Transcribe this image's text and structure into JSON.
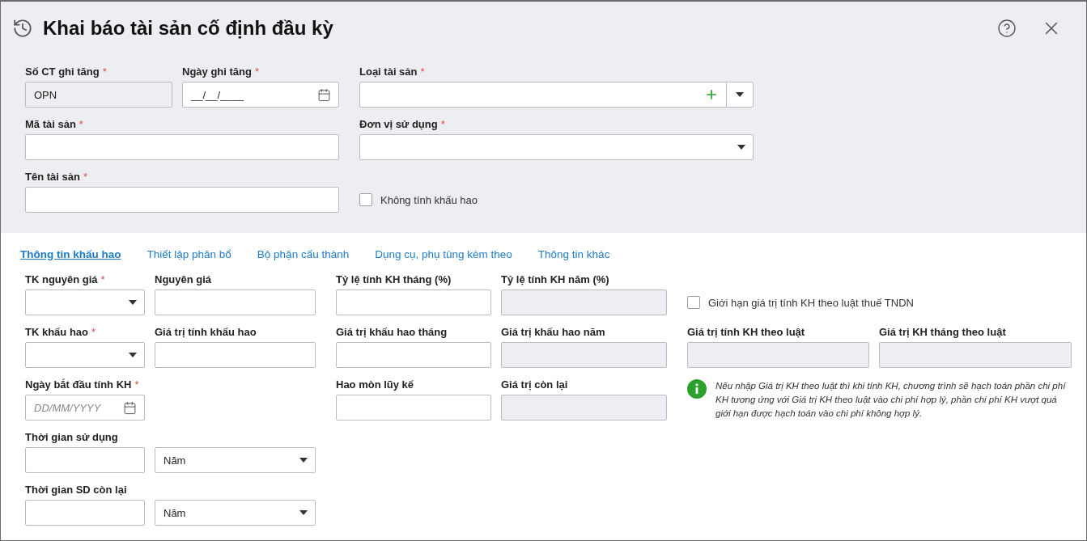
{
  "window": {
    "title": "Khai báo tài sản cố định đầu kỳ"
  },
  "top_fields": [
    {
      "kind": "text",
      "label": "Số CT ghi tăng",
      "required_mark": "*",
      "value": "OPN",
      "disabled": true
    },
    {
      "kind": "date",
      "label": "Ngày ghi tăng",
      "required_mark": "*",
      "value": "__/__/____",
      "disabled": false
    },
    {
      "kind": "combo_add",
      "label": "Loại tài sản",
      "required_mark": "*",
      "disabled": false
    },
    {
      "kind": "text",
      "label": "Mã tài sản",
      "required_mark": "*",
      "disabled": false
    },
    {
      "kind": "combo",
      "label": "Đơn vị sử dụng",
      "required_mark": "*",
      "disabled": false
    },
    {
      "kind": "text",
      "label": "Tên tài sản",
      "required_mark": "*",
      "disabled": false
    },
    {
      "kind": "checkbox",
      "label": "Không tính khấu hao",
      "checked": false
    }
  ],
  "tabs": [
    {
      "label": "Thông tin khấu hao",
      "selected": true
    },
    {
      "label": "Thiết lập phân bổ",
      "selected": false
    },
    {
      "label": "Bộ phận cấu thành",
      "selected": false
    },
    {
      "label": "Dụng cụ, phụ tùng kèm theo",
      "selected": false
    },
    {
      "label": "Thông tin khác",
      "selected": false
    }
  ],
  "detail_fields": [
    {
      "kind": "combo",
      "label": "TK nguyên giá",
      "required_mark": "*",
      "disabled": false
    },
    {
      "kind": "text",
      "label": "Nguyên giá",
      "disabled": false
    },
    {
      "kind": "text",
      "label": "Tỷ lệ tính KH tháng (%)",
      "disabled": false
    },
    {
      "kind": "text",
      "label": "Tỷ lệ tính KH năm (%)",
      "disabled": true
    },
    {
      "kind": "checkbox",
      "label": "Giới hạn giá trị tính KH theo luật thuế TNDN",
      "checked": false
    },
    {
      "kind": "combo",
      "label": "TK khấu hao",
      "required_mark": "*",
      "disabled": false
    },
    {
      "kind": "text",
      "label": "Giá trị tính khấu hao",
      "disabled": false
    },
    {
      "kind": "text",
      "label": "Giá trị khấu hao tháng",
      "disabled": false
    },
    {
      "kind": "text",
      "label": "Giá trị khấu hao năm",
      "disabled": true
    },
    {
      "kind": "text",
      "label": "Giá trị tính KH theo luật",
      "disabled": true
    },
    {
      "kind": "text",
      "label": "Giá trị KH tháng theo luật",
      "disabled": true
    },
    {
      "kind": "date",
      "label": "Ngày bắt đầu tính KH",
      "required_mark": "*",
      "placeholder": "DD/MM/YYYY",
      "disabled": false
    },
    {
      "kind": "text",
      "label": "Hao mòn lũy kế",
      "disabled": false
    },
    {
      "kind": "text",
      "label": "Giá trị còn lại",
      "disabled": true
    },
    {
      "kind": "note",
      "text": "Nếu nhập Giá trị KH theo luật thì khi tính KH, chương trình sẽ hạch toán phần chi phí KH tương ứng với Giá trị KH theo luật vào chi phí hợp lý, phần chi phí KH vượt quá giới hạn được hạch toán vào chi phí không hợp lý."
    },
    {
      "kind": "text",
      "label": "Thời gian sử dụng",
      "disabled": false
    },
    {
      "kind": "select",
      "value": "Năm",
      "disabled": false
    },
    {
      "kind": "text",
      "label": "Thời gian SD còn lại",
      "disabled": false
    },
    {
      "kind": "select",
      "value": "Năm",
      "disabled": false
    }
  ]
}
